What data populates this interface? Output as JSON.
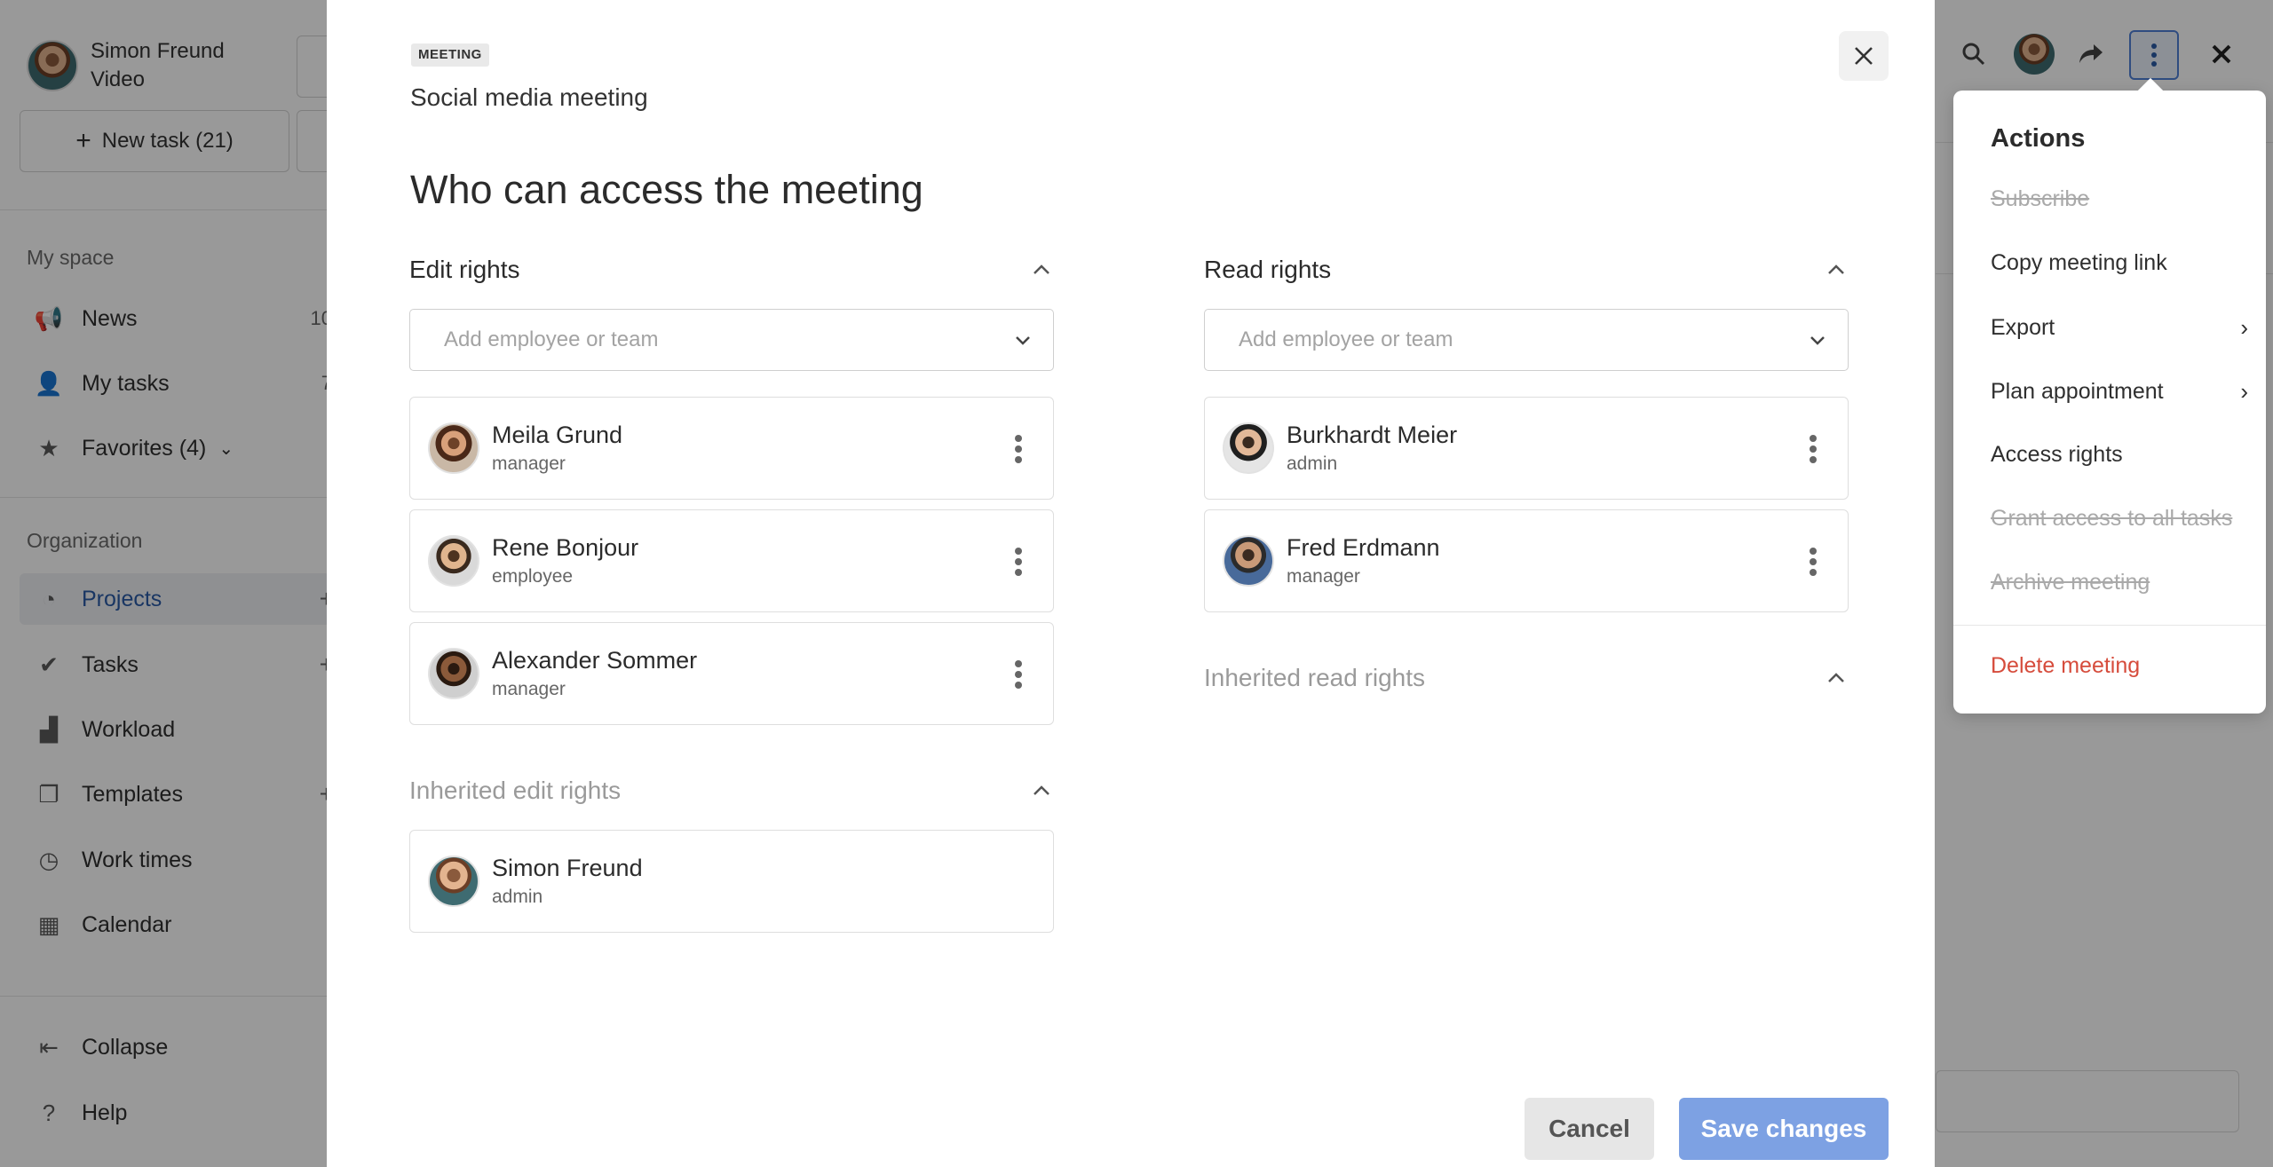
{
  "sidebar": {
    "user": {
      "name": "Simon Freund",
      "subtitle": "Video"
    },
    "new_task_label": "New task (21)",
    "my_space": {
      "label": "My space",
      "items": [
        {
          "label": "News",
          "icon": "megaphone-icon",
          "count": "10"
        },
        {
          "label": "My tasks",
          "icon": "user-icon",
          "count": "7"
        },
        {
          "label": "Favorites (4)",
          "icon": "star-icon"
        }
      ]
    },
    "organization": {
      "label": "Organization",
      "items": [
        {
          "label": "Projects",
          "icon": "pie-chart-icon",
          "active": true
        },
        {
          "label": "Tasks",
          "icon": "check-circle-icon"
        },
        {
          "label": "Workload",
          "icon": "chart-icon"
        },
        {
          "label": "Templates",
          "icon": "copy-icon"
        },
        {
          "label": "Work times",
          "icon": "clock-icon"
        },
        {
          "label": "Calendar",
          "icon": "calendar-icon"
        }
      ]
    },
    "footer": [
      {
        "label": "Collapse",
        "icon": "collapse-icon"
      },
      {
        "label": "Help",
        "icon": "help-icon"
      }
    ]
  },
  "actions_menu": {
    "title": "Actions",
    "items": [
      {
        "label": "Subscribe",
        "state": "disabled"
      },
      {
        "label": "Copy meeting link",
        "state": "normal"
      },
      {
        "label": "Export",
        "state": "normal",
        "submenu": true
      },
      {
        "label": "Plan appointment",
        "state": "normal",
        "submenu": true
      },
      {
        "label": "Access rights",
        "state": "normal"
      },
      {
        "label": "Grant access to all tasks",
        "state": "disabled"
      },
      {
        "label": "Archive meeting",
        "state": "disabled"
      },
      {
        "label": "Delete meeting",
        "state": "danger"
      }
    ]
  },
  "modal": {
    "badge": "MEETING",
    "subtitle": "Social media meeting",
    "title": "Who can access the meeting",
    "edit_rights": {
      "label": "Edit rights",
      "placeholder": "Add employee or team",
      "people": [
        {
          "name": "Meila Grund",
          "role": "manager"
        },
        {
          "name": "Rene Bonjour",
          "role": "employee"
        },
        {
          "name": "Alexander Sommer",
          "role": "manager"
        }
      ]
    },
    "inherited_edit_rights": {
      "label": "Inherited edit rights",
      "people": [
        {
          "name": "Simon Freund",
          "role": "admin"
        }
      ]
    },
    "read_rights": {
      "label": "Read rights",
      "placeholder": "Add employee or team",
      "people": [
        {
          "name": "Burkhardt Meier",
          "role": "admin"
        },
        {
          "name": "Fred Erdmann",
          "role": "manager"
        }
      ]
    },
    "inherited_read_rights": {
      "label": "Inherited read rights"
    },
    "cancel_label": "Cancel",
    "save_label": "Save changes"
  },
  "colors": {
    "accent": "#4f7fd6",
    "save_button": "#7da1e3",
    "danger": "#d64c3c",
    "overlay": "rgba(0,0,0,0.40)"
  }
}
